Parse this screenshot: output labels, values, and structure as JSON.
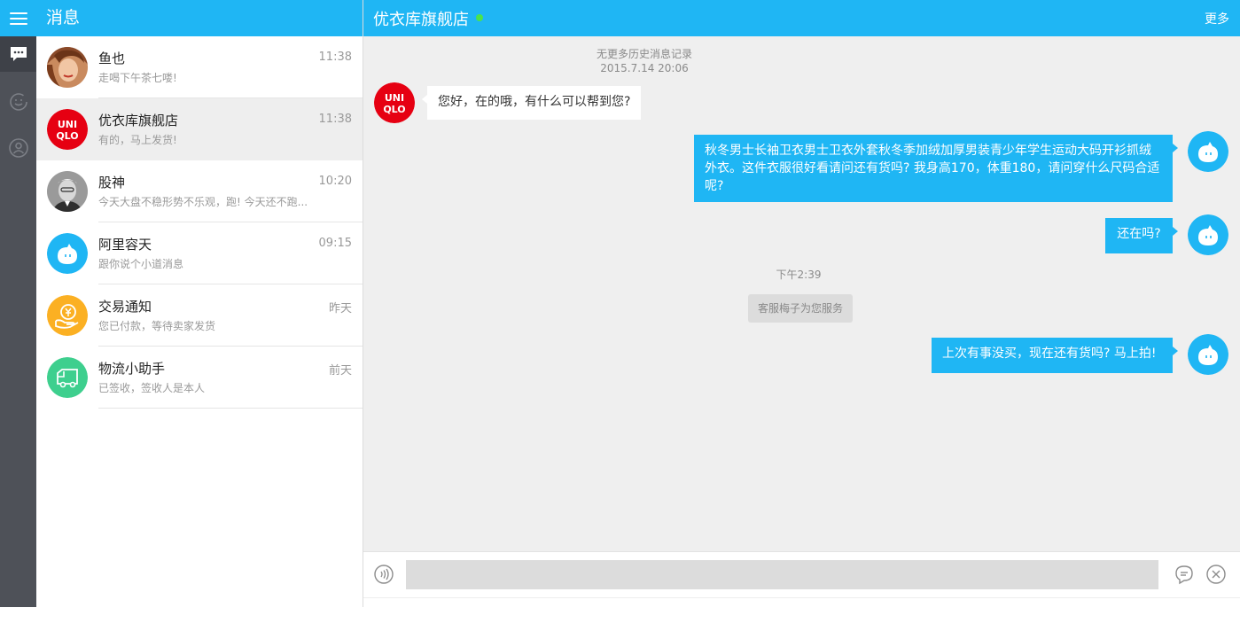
{
  "sidebar": {
    "icons": [
      "menu-icon",
      "chat-bubble-icon",
      "smiley-icon",
      "contacts-icon"
    ]
  },
  "list": {
    "title": "消息",
    "conversations": [
      {
        "name": "鱼也",
        "time": "11:38",
        "preview": "走喝下午茶七喽!",
        "avatar": "portrait-photo"
      },
      {
        "name": "优衣库旗舰店",
        "time": "11:38",
        "preview": "有的，马上发货!",
        "avatar": "uniqlo-logo"
      },
      {
        "name": "股神",
        "time": "10:20",
        "preview": "今天大盘不稳形势不乐观，跑! 今天还不跑...",
        "avatar": "portrait-photo"
      },
      {
        "name": "阿里容天",
        "time": "09:15",
        "preview": "跟你说个小道消息",
        "avatar": "mascot-icon"
      },
      {
        "name": "交易通知",
        "time": "昨天",
        "preview": "您已付款，等待卖家发货",
        "avatar": "money-hand-icon"
      },
      {
        "name": "物流小助手",
        "time": "前天",
        "preview": "已签收，签收人是本人",
        "avatar": "truck-icon"
      }
    ]
  },
  "chat": {
    "title": "优衣库旗舰店",
    "more": "更多",
    "no_more_history": "无更多历史消息记录",
    "history_time": "2015.7.14 20:06",
    "uniqlo_logo": [
      "UNI",
      "QLO"
    ],
    "messages": {
      "m1": "您好，在的哦，有什么可以帮到您?",
      "m2": "秋冬男士长袖卫衣男士卫衣外套秋冬季加绒加厚男装青少年学生运动大码开衫抓绒外衣。这件衣服很好看请问还有货吗? 我身高170，体重180，请问穿什么尺码合适呢?",
      "m3": "还在吗?",
      "m4": "上次有事没买，现在还有货吗? 马上拍!"
    },
    "time_divider": "下午2:39",
    "service_notice": "客服梅子为您服务",
    "status_color": "#4be34b"
  },
  "input": {
    "value": "",
    "placeholder": ""
  },
  "colors": {
    "accent": "#1fb6f4",
    "rail": "#4e5158",
    "chat_bg": "#efefef",
    "trade_orange": "#fbb023",
    "logistics_green": "#3ecf8e",
    "uniqlo_red": "#e60012"
  }
}
